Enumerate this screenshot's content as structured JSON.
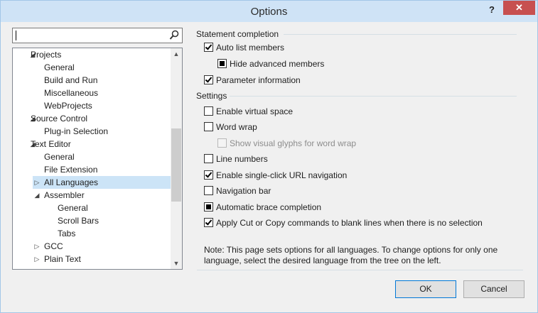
{
  "window": {
    "title": "Options",
    "help_label": "?",
    "close_label": "✕"
  },
  "search": {
    "value": "",
    "placeholder": ""
  },
  "tree": {
    "items": [
      {
        "label": "Projects",
        "expander": "◢"
      },
      {
        "label": "General"
      },
      {
        "label": "Build and Run"
      },
      {
        "label": "Miscellaneous"
      },
      {
        "label": "WebProjects"
      },
      {
        "label": "Source Control",
        "expander": "◢"
      },
      {
        "label": "Plug-in Selection"
      },
      {
        "label": "Text Editor",
        "expander": "◢"
      },
      {
        "label": "General"
      },
      {
        "label": "File Extension"
      },
      {
        "label": "All Languages",
        "expander": "▷",
        "selected": true
      },
      {
        "label": "Assembler",
        "expander": "◢"
      },
      {
        "label": "General"
      },
      {
        "label": "Scroll Bars"
      },
      {
        "label": "Tabs"
      },
      {
        "label": "GCC",
        "expander": "▷"
      },
      {
        "label": "Plain Text",
        "expander": "▷"
      }
    ],
    "scroll_up": "▲",
    "scroll_down": "▼"
  },
  "statement_completion": {
    "header": "Statement completion",
    "auto_list_members": {
      "label": "Auto list members",
      "state": "checked"
    },
    "hide_advanced_members": {
      "label": "Hide advanced members",
      "state": "indeterminate"
    },
    "parameter_information": {
      "label": "Parameter information",
      "state": "checked"
    }
  },
  "settings": {
    "header": "Settings",
    "enable_virtual_space": {
      "label": "Enable virtual space",
      "state": "unchecked"
    },
    "word_wrap": {
      "label": "Word wrap",
      "state": "unchecked"
    },
    "show_visual_glyphs": {
      "label": "Show visual glyphs for word wrap",
      "state": "disabled"
    },
    "line_numbers": {
      "label": "Line numbers",
      "state": "unchecked"
    },
    "single_click_url": {
      "label": "Enable single-click URL navigation",
      "state": "checked"
    },
    "navigation_bar": {
      "label": "Navigation bar",
      "state": "unchecked"
    },
    "automatic_brace": {
      "label": "Automatic brace completion",
      "state": "indeterminate"
    },
    "apply_cut_copy": {
      "label": "Apply Cut or Copy commands to blank lines when there is no selection",
      "state": "checked"
    }
  },
  "note": "Note: This page sets options for all languages. To change options for only one language, select the desired language from the tree on the left.",
  "buttons": {
    "ok": "OK",
    "cancel": "Cancel"
  }
}
